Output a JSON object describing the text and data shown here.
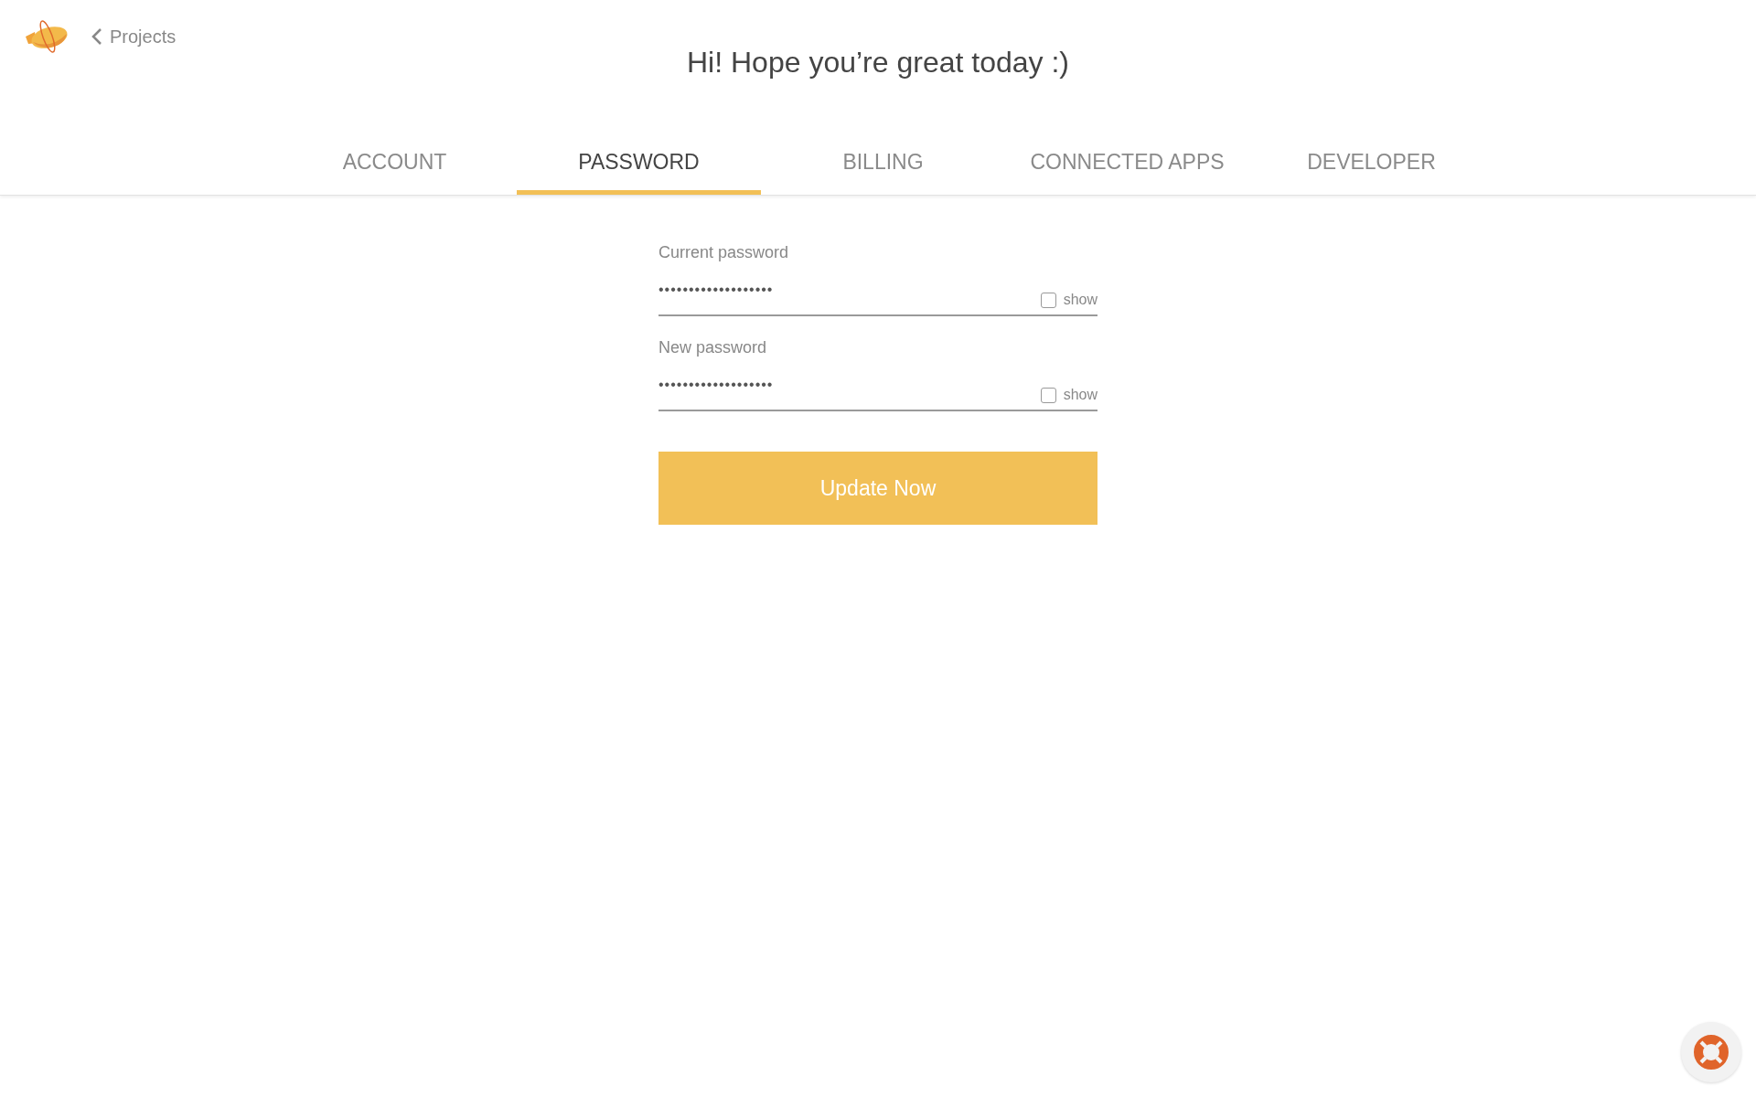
{
  "header": {
    "back_link": "Projects",
    "greeting": "Hi! Hope you’re great today :)"
  },
  "tabs": [
    {
      "label": "ACCOUNT",
      "selected": false
    },
    {
      "label": "PASSWORD",
      "selected": true
    },
    {
      "label": "BILLING",
      "selected": false
    },
    {
      "label": "CONNECTED APPS",
      "selected": false
    },
    {
      "label": "DEVELOPER",
      "selected": false
    }
  ],
  "fields": [
    {
      "label": "Current password",
      "value": "•••••••••••••••••••",
      "show_label": "show",
      "checked": false
    },
    {
      "label": "New password",
      "value": "•••••••••••••••••••",
      "show_label": "show",
      "checked": false
    }
  ],
  "submit_button": "Update Now"
}
